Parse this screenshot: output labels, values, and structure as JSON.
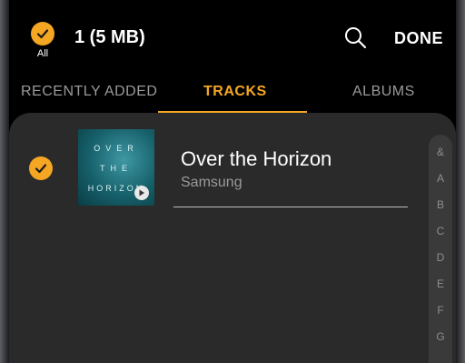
{
  "header": {
    "select_all_label": "All",
    "selection_count": "1 (5 MB)",
    "done_label": "DONE"
  },
  "tabs": [
    {
      "label": "RECENTLY ADDED"
    },
    {
      "label": "TRACKS"
    },
    {
      "label": "ALBUMS"
    }
  ],
  "track": {
    "title": "Over the Horizon",
    "artist": "Samsung",
    "art_lines": [
      "OVER",
      "THE",
      "HORIZON"
    ]
  },
  "index_letters": [
    "&",
    "A",
    "B",
    "C",
    "D",
    "E",
    "F",
    "G"
  ],
  "colors": {
    "accent": "#f5a623",
    "background": "#000000",
    "sheet": "#2a2a2a"
  },
  "icons": {
    "search": "search-icon",
    "check": "check-icon",
    "play": "play-icon"
  }
}
